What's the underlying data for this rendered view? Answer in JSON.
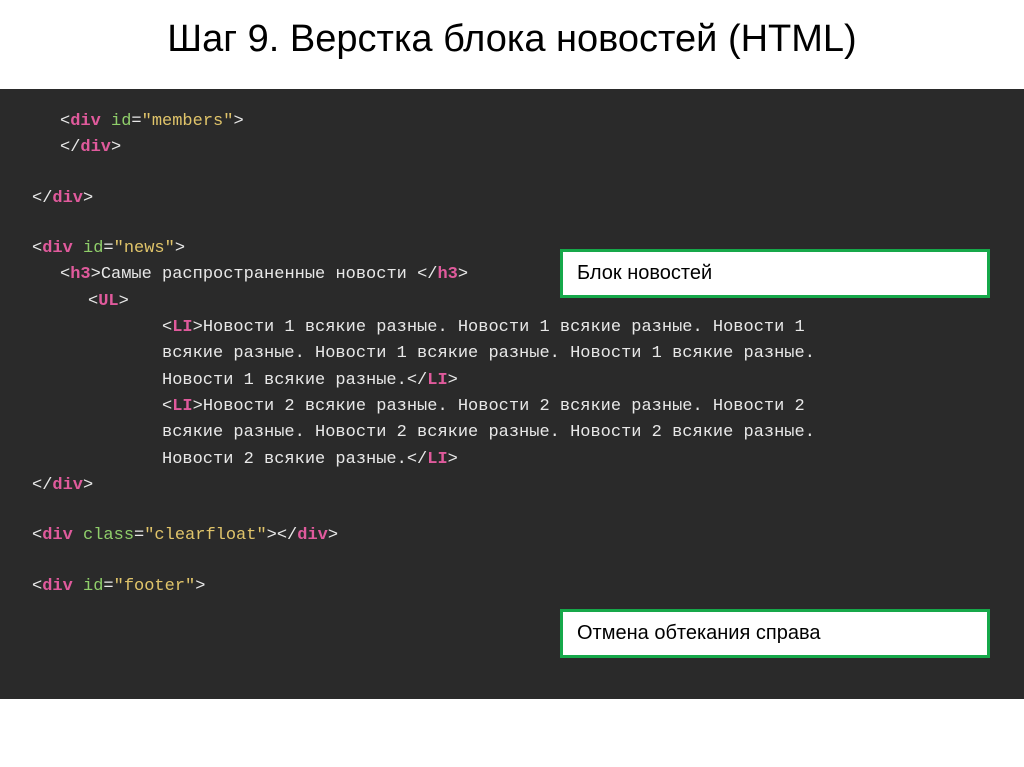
{
  "title": "Шаг 9. Верстка блока новостей (HTML)",
  "code": {
    "l1_open": "<div id=\"members\">",
    "l1_close": "</div>",
    "outer_close": "</div>",
    "news_open": "<div id=\"news\">",
    "h3_open": "<h3>",
    "h3_text": "Самые распространенные новости ",
    "h3_close": "</h3>",
    "ul_open": "<UL>",
    "li_open": "<LI>",
    "li1_text_a": "Новости 1 всякие разные. Новости 1 всякие разные. Новости 1",
    "li1_text_b": "всякие разные. Новости 1 всякие разные. Новости 1 всякие разные.",
    "li1_text_c": "Новости 1 всякие разные.",
    "li2_text_a": "Новости 2 всякие разные. Новости 2 всякие разные. Новости 2",
    "li2_text_b": "всякие разные. Новости 2 всякие разные. Новости 2 всякие разные.",
    "li2_text_c": "Новости 2 всякие разные.",
    "li_close": "</LI>",
    "news_close": "</div>",
    "clearfloat": "<div class=\"clearfloat\"></div>",
    "footer_open": "<div id=\"footer\">"
  },
  "annotations": {
    "news_block": "Блок новостей",
    "clear_float": "Отмена обтекания справа"
  }
}
